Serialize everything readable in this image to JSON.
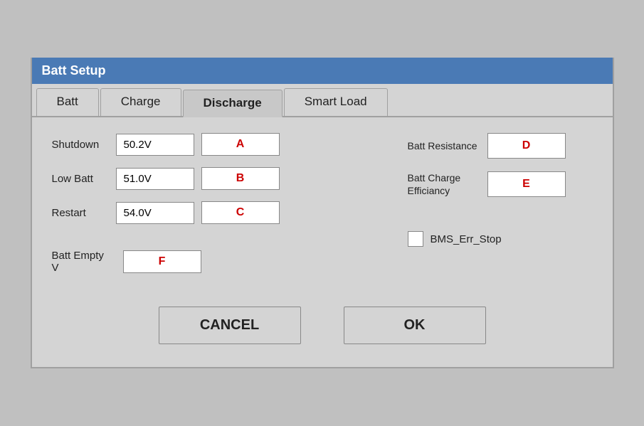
{
  "dialog": {
    "title": "Batt Setup",
    "tabs": [
      {
        "id": "batt",
        "label": "Batt",
        "active": false
      },
      {
        "id": "charge",
        "label": "Charge",
        "active": false
      },
      {
        "id": "discharge",
        "label": "Discharge",
        "active": true
      },
      {
        "id": "smart-load",
        "label": "Smart Load",
        "active": false
      }
    ]
  },
  "left_fields": [
    {
      "label": "Shutdown",
      "value": "50.2V",
      "btn": "A"
    },
    {
      "label": "Low Batt",
      "value": "51.0V",
      "btn": "B"
    },
    {
      "label": "Restart",
      "value": "54.0V",
      "btn": "C"
    }
  ],
  "batt_empty": {
    "label": "Batt Empty V",
    "btn": "F"
  },
  "right_fields": [
    {
      "label": "Batt Resistance",
      "btn": "D"
    },
    {
      "label": "Batt Charge Efficiancy",
      "btn": "E"
    }
  ],
  "bms_err_stop": {
    "label": "BMS_Err_Stop",
    "checked": false
  },
  "buttons": {
    "cancel": "CANCEL",
    "ok": "OK"
  }
}
